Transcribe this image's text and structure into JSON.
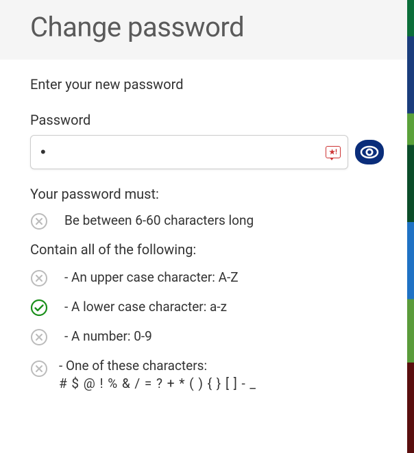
{
  "header": {
    "title": "Change password"
  },
  "form": {
    "prompt": "Enter your new password",
    "password_label": "Password",
    "password_value": "•",
    "badge_text": "★!"
  },
  "rules": {
    "must_label": "Your password must:",
    "length": "Be between 6-60 characters long",
    "contain_label": "Contain all of the following:",
    "upper": "- An upper case character: A-Z",
    "lower": "- A lower case character: a-z",
    "number": "- A number: 0-9",
    "special_line1": "- One of these characters:",
    "special_line2": "# $ @ ! % & / = ? + * ( ) { } [ ] - _"
  },
  "status": {
    "length": false,
    "upper": false,
    "lower": true,
    "number": false,
    "special": false
  }
}
